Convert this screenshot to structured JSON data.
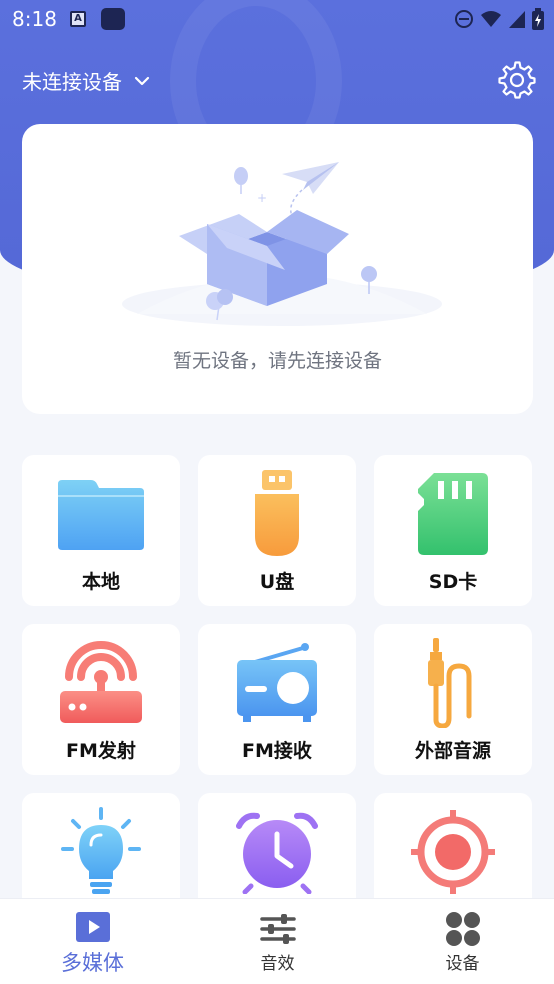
{
  "status_bar": {
    "time": "8:18"
  },
  "header": {
    "device_label": "未连接设备"
  },
  "empty_state": {
    "message": "暂无设备，请先连接设备"
  },
  "tiles": [
    {
      "label": "本地",
      "icon": "folder-icon"
    },
    {
      "label": "U盘",
      "icon": "usb-drive-icon"
    },
    {
      "label": "SD卡",
      "icon": "sd-card-icon"
    },
    {
      "label": "FM发射",
      "icon": "fm-transmitter-icon"
    },
    {
      "label": "FM接收",
      "icon": "radio-icon"
    },
    {
      "label": "外部音源",
      "icon": "aux-cable-icon"
    },
    {
      "label": "",
      "icon": "light-bulb-icon"
    },
    {
      "label": "",
      "icon": "alarm-clock-icon"
    },
    {
      "label": "",
      "icon": "target-icon"
    }
  ],
  "bottom_nav": [
    {
      "label": "多媒体",
      "icon": "play-icon",
      "active": true
    },
    {
      "label": "音效",
      "icon": "equalizer-icon",
      "active": false
    },
    {
      "label": "设备",
      "icon": "device-grid-icon",
      "active": false
    }
  ],
  "colors": {
    "primary": "#5a6fd8",
    "background": "#f4f6fb"
  }
}
